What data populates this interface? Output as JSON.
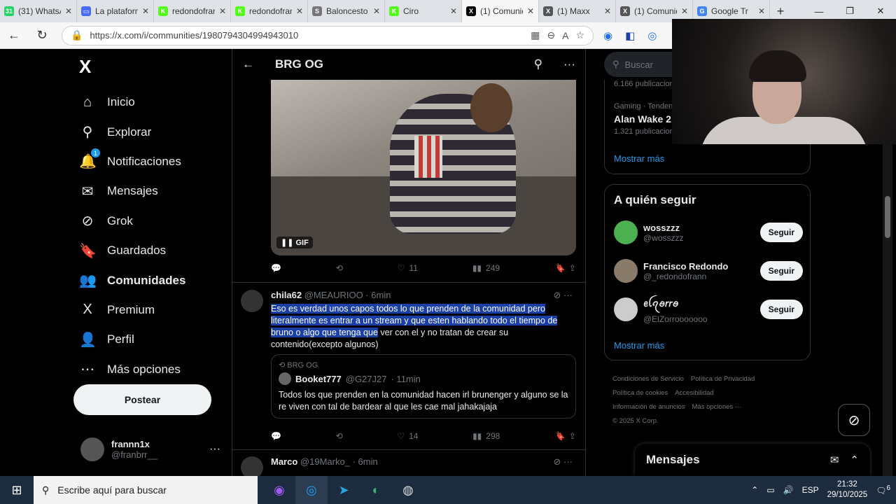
{
  "browser": {
    "tabs": [
      {
        "title": "(31) WhatsApp",
        "color": "#25d366",
        "icon": "31"
      },
      {
        "title": "La plataforma",
        "color": "#4a6cf7",
        "icon": "▭"
      },
      {
        "title": "redondofrann",
        "color": "#53fc18",
        "icon": "K"
      },
      {
        "title": "redondofrann",
        "color": "#53fc18",
        "icon": "K"
      },
      {
        "title": "Baloncesto",
        "color": "#777777",
        "icon": "S"
      },
      {
        "title": "Ciro",
        "color": "#53fc18",
        "icon": "K"
      },
      {
        "title": "(1) Comunidad",
        "color": "#000000",
        "icon": "X",
        "active": true
      },
      {
        "title": "(1) Maxx",
        "color": "#555555",
        "icon": "X"
      },
      {
        "title": "(1) Comunidad",
        "color": "#555555",
        "icon": "X"
      },
      {
        "title": "Google Tr",
        "color": "#4285f4",
        "icon": "G"
      }
    ],
    "url": "https://x.com/i/communities/1980794304994943010"
  },
  "sidebar": {
    "logo": "X",
    "items": [
      {
        "label": "Inicio",
        "icon": "⌂"
      },
      {
        "label": "Explorar",
        "icon": "⚲"
      },
      {
        "label": "Notificaciones",
        "icon": "🔔",
        "badge": "1"
      },
      {
        "label": "Mensajes",
        "icon": "✉"
      },
      {
        "label": "Grok",
        "icon": "⊘"
      },
      {
        "label": "Guardados",
        "icon": "🔖"
      },
      {
        "label": "Comunidades",
        "icon": "👥",
        "active": true
      },
      {
        "label": "Premium",
        "icon": "X"
      },
      {
        "label": "Perfil",
        "icon": "👤"
      },
      {
        "label": "Más opciones",
        "icon": "⋯"
      }
    ],
    "post_label": "Postear",
    "user": {
      "name": "frannn1x",
      "handle": "@franbrr__"
    }
  },
  "center": {
    "title": "BRG OG",
    "gif_label": "GIF",
    "post1_actions": {
      "replies": "",
      "reposts": "",
      "likes": "11",
      "views": "249"
    },
    "tweet": {
      "name": "chila62",
      "handle": "@MEAURIOO",
      "time": "· 6min",
      "text_highlighted": "Eso es verdad unos capos todos lo que prenden de la comunidad pero literalmente es entrar a un stream y que esten hablando todo el tiempo de bruno o algo que tenga que",
      "text_rest": " ver con el y no tratan de crear su contenido(excepto algunos)",
      "quote": {
        "community": "BRG OG",
        "name": "Booket777",
        "handle": "@G27J27",
        "time": "· 11min",
        "text": "Todos los que prenden en la comunidad hacen irl brunenger y alguno se la re viven con tal de bardear al que les cae mal jahakajaja"
      },
      "actions": {
        "likes": "14",
        "views": "298"
      }
    },
    "next_tweet": {
      "name": "Marco",
      "handle": "@19Marko_",
      "time": "· 6min"
    }
  },
  "right": {
    "search_placeholder": "Buscar",
    "trend_partial": "6.166 publicaciones",
    "trend": {
      "category": "Gaming · Tendencia",
      "title": "Alan Wake 2",
      "count": "1.321 publicaciones"
    },
    "show_more": "Mostrar más",
    "follow_title": "A quién seguir",
    "follow": [
      {
        "name": "wosszzz",
        "handle": "@wosszzz",
        "btn": "Seguir",
        "color": "#4caf50"
      },
      {
        "name": "Francisco Redondo",
        "handle": "@_redondofrann",
        "btn": "Seguir",
        "color": "#8a7a6a"
      },
      {
        "name": "ꫀꪶꪖꪮ𝘳𝘳ꪮ",
        "handle": "@ElZorrooooooo",
        "btn": "Seguir",
        "color": "#cccccc"
      }
    ],
    "footer": [
      "Condiciones de Servicio",
      "Política de Privacidad",
      "Política de cookies",
      "Accesibilidad",
      "Información de anuncios",
      "Más opciones ···",
      "© 2025 X Corp."
    ],
    "messages": "Mensajes"
  },
  "taskbar": {
    "search_placeholder": "Escribe aquí para buscar",
    "lang": "ESP",
    "time": "21:32",
    "date": "29/10/2025",
    "notif": "6"
  }
}
